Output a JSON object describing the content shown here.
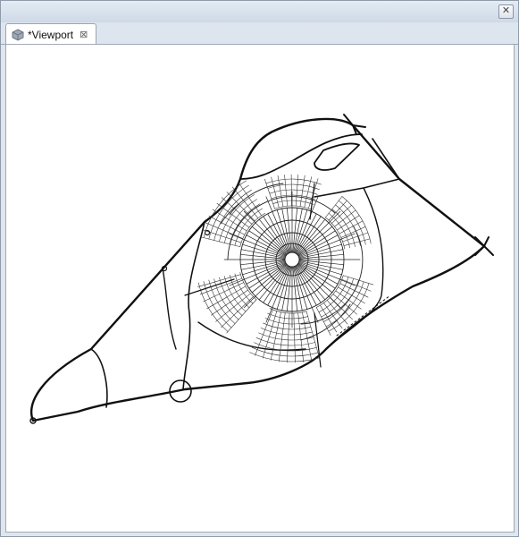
{
  "window": {
    "close_glyph": "✕"
  },
  "tab": {
    "label": "*Viewport",
    "icon": "cube-icon",
    "close_glyph": "⊠"
  },
  "toolbar": {
    "buttons": [
      "viewport-icon",
      "edges-icon",
      "grid-icon",
      "cube-icon",
      "layers-icon",
      "fit-view-icon",
      "camera-icon",
      "gear-icon",
      "star-icon"
    ],
    "dropdown_glyph": "▾"
  },
  "colors": {
    "accent": "#3c7fd0",
    "line": "#111111",
    "viewport_bg": "#ffffff"
  }
}
